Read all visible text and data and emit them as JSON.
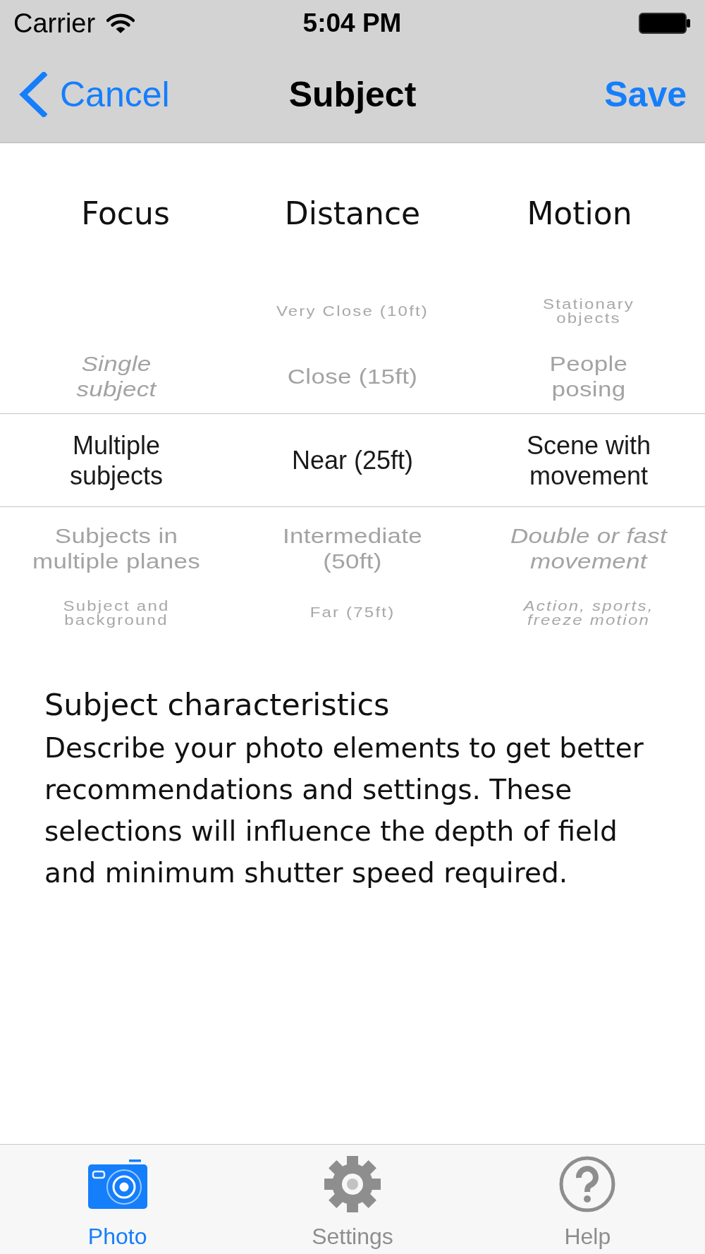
{
  "status_bar": {
    "carrier": "Carrier",
    "time": "5:04 PM"
  },
  "nav_bar": {
    "back": "Cancel",
    "title": "Subject",
    "action": "Save"
  },
  "pickers": [
    {
      "title": "Focus",
      "items": [
        {
          "label": "Single\nsubject",
          "selected": false,
          "italic": true
        },
        {
          "label": "Multiple\nsubjects",
          "selected": true,
          "italic": false
        },
        {
          "label": "Subjects in\nmultiple planes",
          "selected": false,
          "italic": false
        },
        {
          "label": "Subject and\nbackground",
          "selected": false,
          "italic": false
        }
      ]
    },
    {
      "title": "Distance",
      "items": [
        {
          "label": "Very Close (10ft)",
          "selected": false,
          "italic": false
        },
        {
          "label": "Close (15ft)",
          "selected": false,
          "italic": false
        },
        {
          "label": "Near (25ft)",
          "selected": true,
          "italic": false
        },
        {
          "label": "Intermediate\n(50ft)",
          "selected": false,
          "italic": false
        },
        {
          "label": "Far (75ft)",
          "selected": false,
          "italic": false
        }
      ]
    },
    {
      "title": "Motion",
      "items": [
        {
          "label": "Stationary\nobjects",
          "selected": false,
          "italic": false
        },
        {
          "label": "People\nposing",
          "selected": false,
          "italic": false
        },
        {
          "label": "Scene with\nmovement",
          "selected": true,
          "italic": false
        },
        {
          "label": "Double or fast\nmovement",
          "selected": false,
          "italic": true
        },
        {
          "label": "Action, sports,\nfreeze motion",
          "selected": false,
          "italic": true
        }
      ]
    }
  ],
  "description": {
    "title": "Subject characteristics",
    "text": "Describe your photo elements to get better recommendations and settings. These selections will influence the depth of field and minimum shutter speed required."
  },
  "tabs": [
    {
      "label": "Photo",
      "kind": "camera",
      "selected": true
    },
    {
      "label": "Settings",
      "kind": "gear",
      "selected": false
    },
    {
      "label": "Help",
      "kind": "help",
      "selected": false
    }
  ]
}
